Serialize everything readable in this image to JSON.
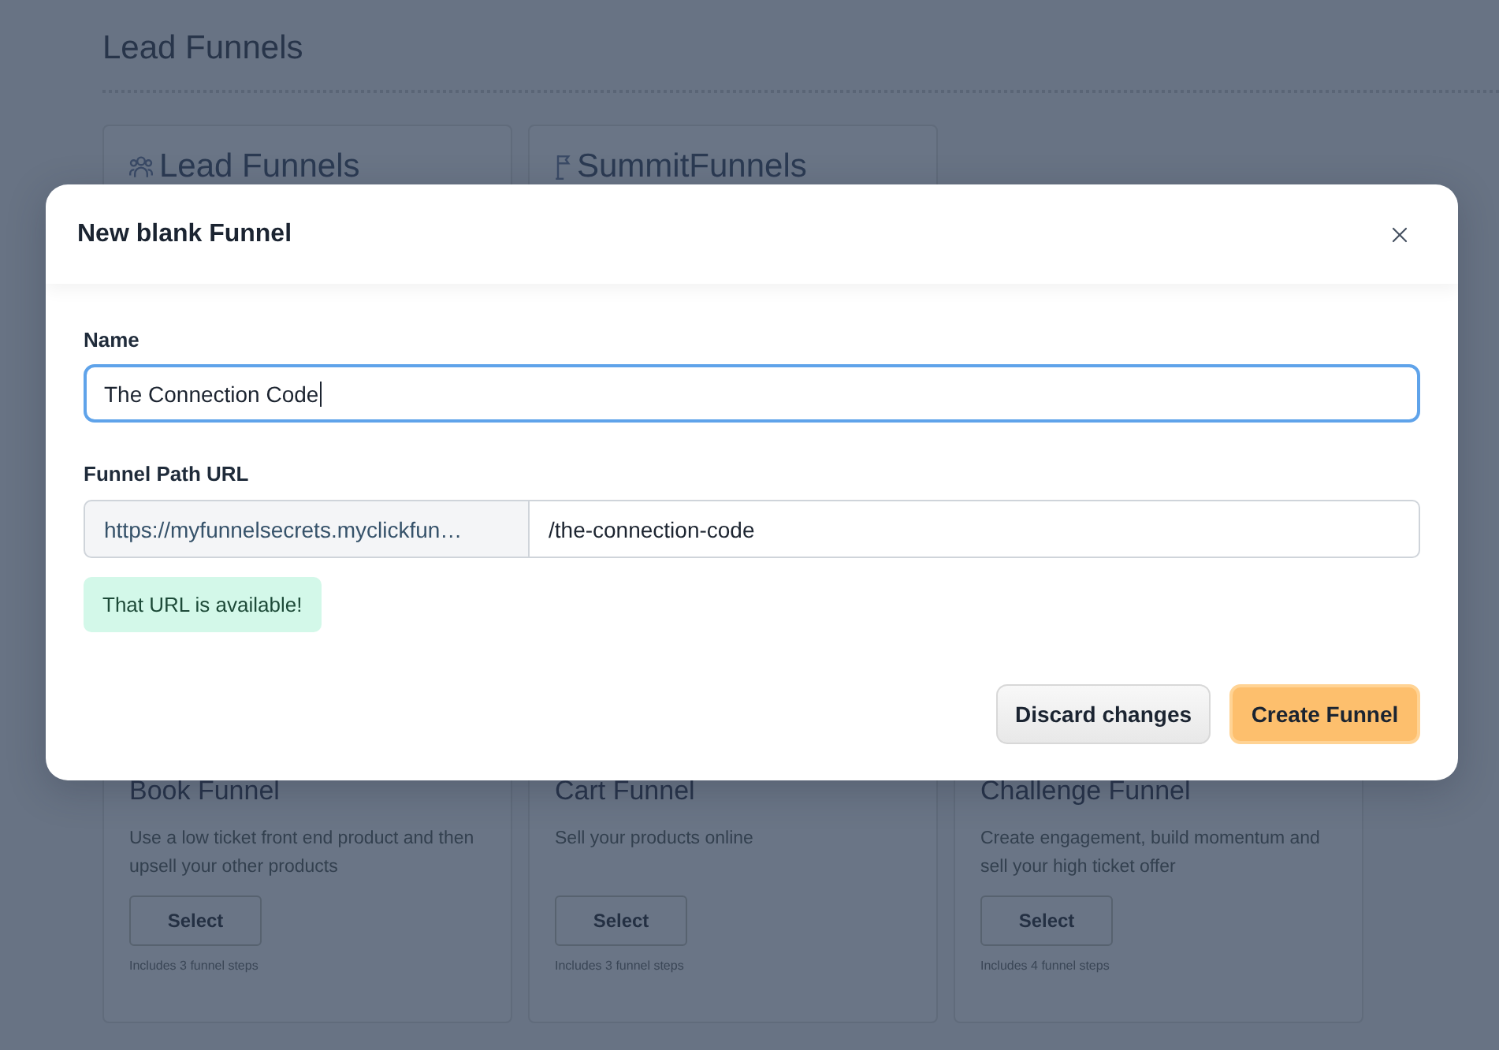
{
  "page": {
    "title": "Lead Funnels"
  },
  "lead_cards": [
    {
      "title": "Lead Funnels"
    },
    {
      "title": "SummitFunnels"
    }
  ],
  "template_cards": [
    {
      "title": "Book Funnel",
      "description": "Use a low ticket front end product and then upsell your other products",
      "button": "Select",
      "note": "Includes 3 funnel steps"
    },
    {
      "title": "Cart Funnel",
      "description": "Sell your products online",
      "button": "Select",
      "note": "Includes 3 funnel steps"
    },
    {
      "title": "Challenge Funnel",
      "description": "Create engagement, build momentum and sell your high ticket offer",
      "button": "Select",
      "note": "Includes 4 funnel steps"
    }
  ],
  "modal": {
    "title": "New blank Funnel",
    "name_field": {
      "label": "Name",
      "value": "The Connection Code",
      "focused": true
    },
    "url_field": {
      "label": "Funnel Path URL",
      "prefix": "https://myfunnelsecrets.myclickfun…",
      "value": "/the-connection-code"
    },
    "status_message": {
      "text": "That URL is available!",
      "kind": "success"
    },
    "buttons": [
      {
        "label": "Discard changes",
        "kind": "secondary"
      },
      {
        "label": "Create Funnel",
        "kind": "primary"
      }
    ]
  }
}
